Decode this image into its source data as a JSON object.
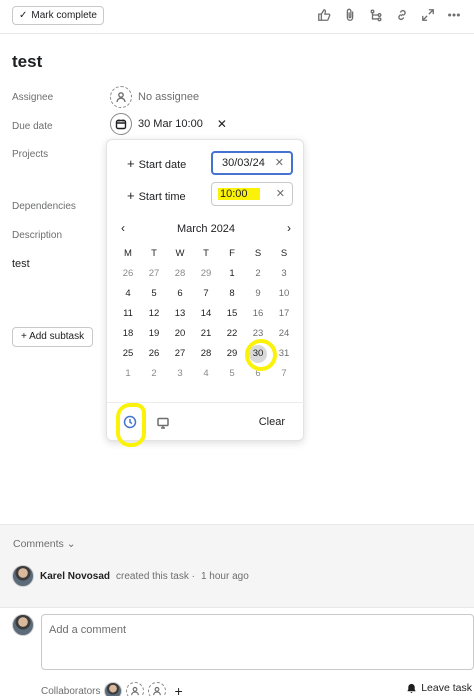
{
  "toolbar": {
    "mark_complete": "Mark complete",
    "icons": [
      "thumbs-up-icon",
      "attachment-icon",
      "subtasks-icon",
      "link-icon",
      "expand-icon",
      "more-icon"
    ]
  },
  "task": {
    "title": "test",
    "fields": {
      "assignee_label": "Assignee",
      "assignee_value": "No assignee",
      "due_label": "Due date",
      "due_value": "30 Mar 10:00",
      "projects_label": "Projects",
      "dependencies_label": "Dependencies",
      "description_label": "Description",
      "description_value": "test"
    },
    "add_subtask": "+ Add subtask"
  },
  "date_picker": {
    "start_date_label": "Start date",
    "start_date_value": "30/03/24",
    "start_time_label": "Start time",
    "start_time_value": "10:00",
    "month_title": "March 2024",
    "weekdays": [
      "M",
      "T",
      "W",
      "T",
      "F",
      "S",
      "S"
    ],
    "weeks": [
      [
        "26",
        "27",
        "28",
        "29",
        "1",
        "2",
        "3"
      ],
      [
        "4",
        "5",
        "6",
        "7",
        "8",
        "9",
        "10"
      ],
      [
        "11",
        "12",
        "13",
        "14",
        "15",
        "16",
        "17"
      ],
      [
        "18",
        "19",
        "20",
        "21",
        "22",
        "23",
        "24"
      ],
      [
        "25",
        "26",
        "27",
        "28",
        "29",
        "30",
        "31"
      ],
      [
        "1",
        "2",
        "3",
        "4",
        "5",
        "6",
        "7"
      ]
    ],
    "selected_day": "30",
    "clear_label": "Clear"
  },
  "comments": {
    "header": "Comments",
    "activity_user": "Karel Novosad",
    "activity_text": "created this task ·",
    "activity_time": "1 hour ago",
    "placeholder": "Add a comment",
    "collaborators_label": "Collaborators",
    "leave_task": "Leave task"
  },
  "colors": {
    "accent": "#4573d2",
    "highlight": "#fbf20a"
  }
}
